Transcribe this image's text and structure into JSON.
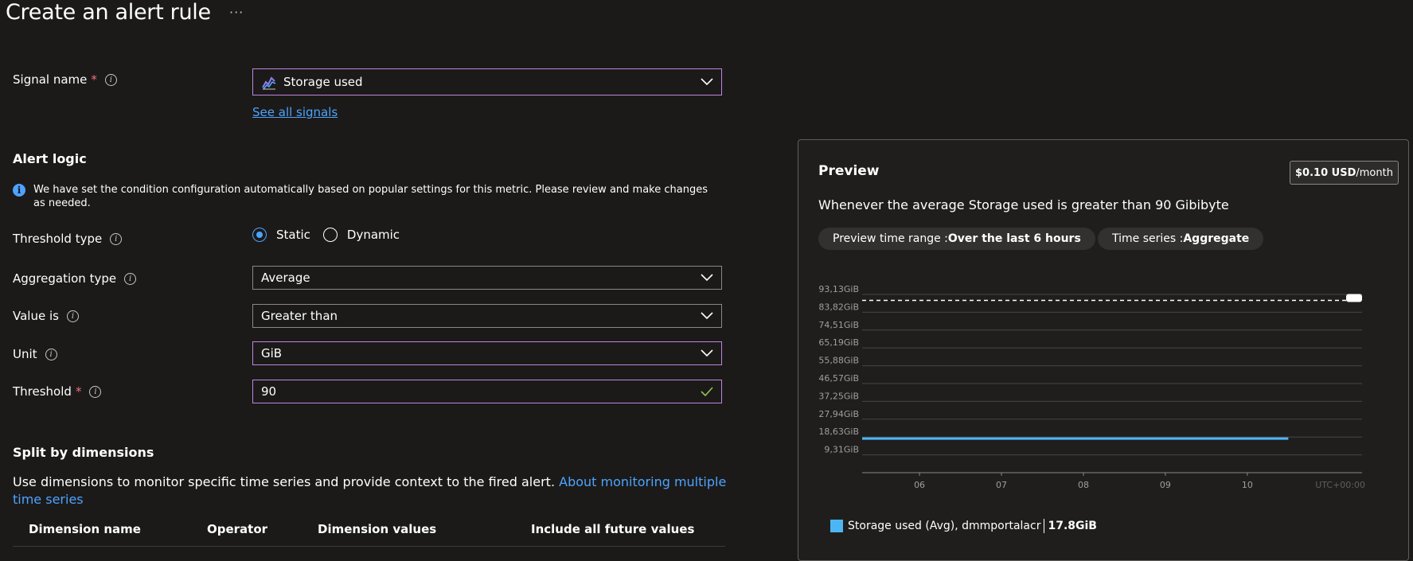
{
  "page": {
    "title": "Create an alert rule",
    "more_label": "···"
  },
  "signal": {
    "label": "Signal name",
    "required_mark": "*",
    "value": "Storage used",
    "see_all": "See all signals"
  },
  "alert_logic": {
    "heading": "Alert logic",
    "banner": "We have set the condition configuration automatically based on popular settings for this metric. Please review and make changes as needed.",
    "threshold_type": {
      "label": "Threshold type",
      "options": [
        "Static",
        "Dynamic"
      ],
      "selected": "Static"
    },
    "aggregation": {
      "label": "Aggregation type",
      "value": "Average"
    },
    "operator": {
      "label": "Value is",
      "value": "Greater than"
    },
    "unit": {
      "label": "Unit",
      "value": "GiB"
    },
    "threshold": {
      "label": "Threshold",
      "required_mark": "*",
      "value": "90"
    }
  },
  "split": {
    "heading": "Split by dimensions",
    "description": "Use dimensions to monitor specific time series and provide context to the fired alert.",
    "link_text": "About monitoring multiple time series",
    "columns": [
      "Dimension name",
      "Operator",
      "Dimension values",
      "Include all future values"
    ]
  },
  "preview": {
    "heading": "Preview",
    "cost_value": "$0.10 USD",
    "cost_unit": "/month",
    "summary": "Whenever the average Storage used is greater than 90 Gibibyte",
    "time_range_label": "Preview time range : ",
    "time_range_value": "Over the last 6 hours",
    "time_series_label": "Time series : ",
    "time_series_value": "Aggregate",
    "legend_name": "Storage used (Avg), dmmportalacr",
    "legend_value": "17.8GiB",
    "timezone": "UTC+00:00",
    "colors": {
      "series": "#4cb6f5",
      "threshold": "#ffffff"
    }
  },
  "chart_data": {
    "type": "line",
    "y_tick_labels": [
      "93,13GiB",
      "83,82GiB",
      "74,51GiB",
      "65,19GiB",
      "55,88GiB",
      "46,57GiB",
      "37,25GiB",
      "27,94GiB",
      "18,63GiB",
      "9,31GiB"
    ],
    "y_ticks": [
      93.13,
      83.82,
      74.51,
      65.19,
      55.88,
      46.57,
      37.25,
      27.94,
      18.63,
      9.31
    ],
    "x_tick_labels": [
      "06",
      "07",
      "08",
      "09",
      "10"
    ],
    "x_ticks": [
      6,
      7,
      8,
      9,
      10
    ],
    "xlim": [
      5.3,
      11.4
    ],
    "ylim": [
      0,
      93.13
    ],
    "series": [
      {
        "name": "Storage used (Avg), dmmportalacr",
        "x": [
          5.3,
          10.5
        ],
        "y": [
          17.8,
          17.8
        ]
      }
    ],
    "threshold": 90
  }
}
